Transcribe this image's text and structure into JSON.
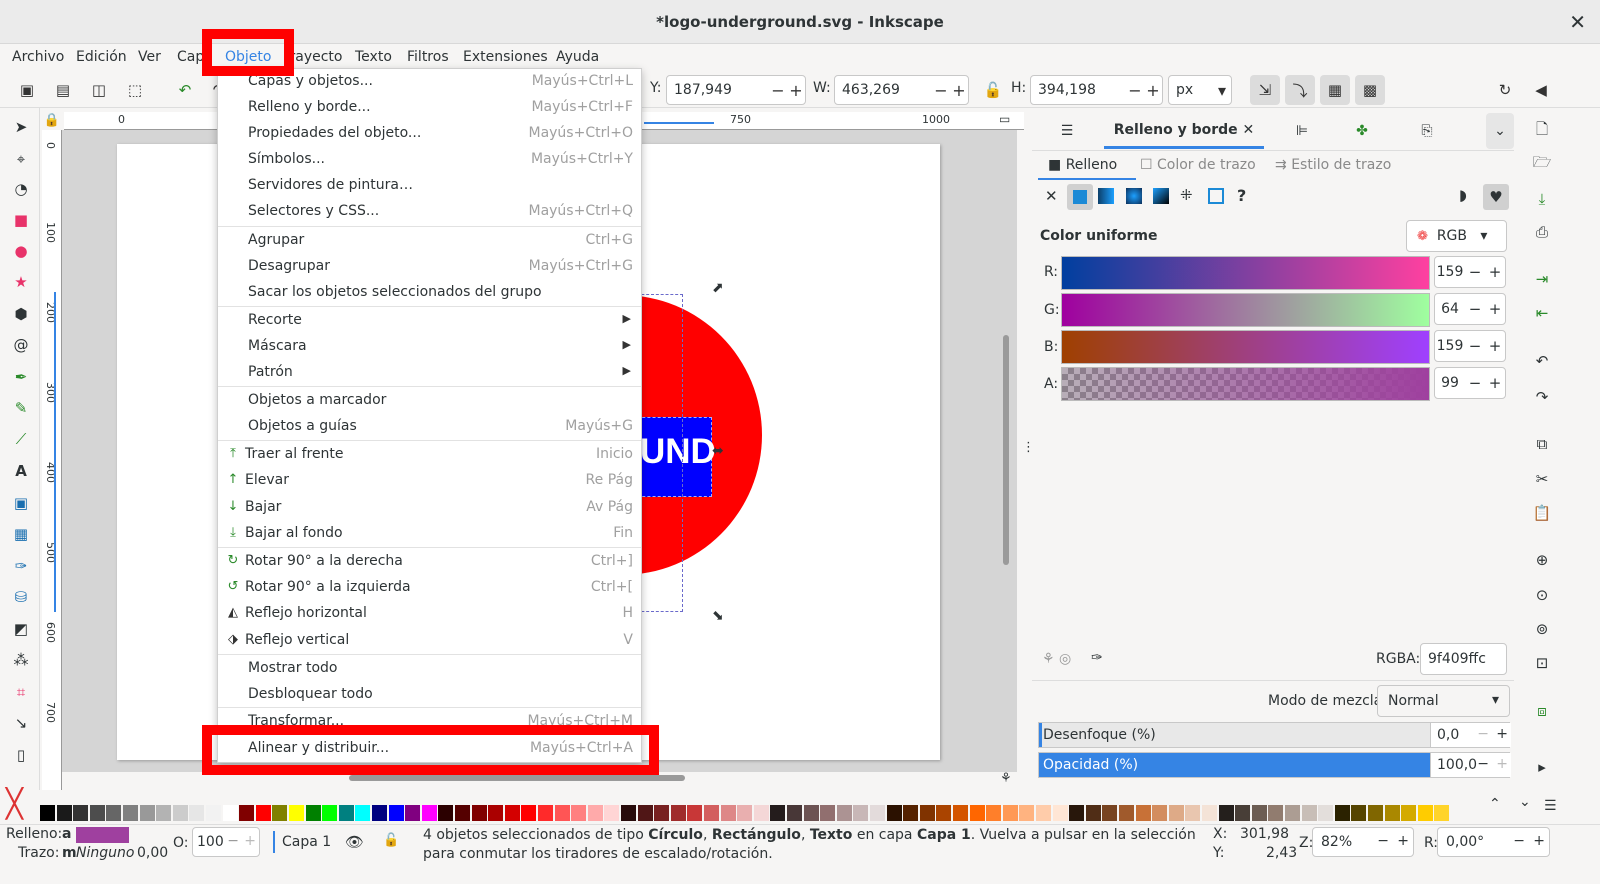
{
  "window": {
    "title": "*logo-underground.svg - Inkscape",
    "close_icon": "close-icon"
  },
  "menubar": [
    "Archivo",
    "Edición",
    "Ver",
    "Capa",
    "Objeto",
    "Trayecto",
    "Texto",
    "Filtros",
    "Extensiones",
    "Ayuda"
  ],
  "toolbar": {
    "y_label": "Y:",
    "y_value": "187,949",
    "w_label": "W:",
    "w_value": "463,269",
    "h_label": "H:",
    "h_value": "394,198",
    "unit": "px"
  },
  "ruler": {
    "top_ticks": [
      "0",
      "750",
      "1000"
    ],
    "left_ticks": [
      "0",
      "100",
      "200",
      "300",
      "400",
      "500",
      "600",
      "700"
    ]
  },
  "canvas": {
    "visible_text": "UND"
  },
  "dropdown": {
    "items": [
      {
        "label": "Capas y objetos...",
        "shortcut": "Mayús+Ctrl+L"
      },
      {
        "label": "Relleno y borde...",
        "shortcut": "Mayús+Ctrl+F"
      },
      {
        "label": "Propiedades del objeto...",
        "shortcut": "Mayús+Ctrl+O"
      },
      {
        "label": "Símbolos...",
        "shortcut": "Mayús+Ctrl+Y"
      },
      {
        "label": "Servidores de pintura…",
        "shortcut": ""
      },
      {
        "label": "Selectores y CSS...",
        "shortcut": "Mayús+Ctrl+Q"
      },
      {
        "label": "Agrupar",
        "shortcut": "Ctrl+G"
      },
      {
        "label": "Desagrupar",
        "shortcut": "Mayús+Ctrl+G"
      },
      {
        "label": "Sacar los objetos seleccionados del grupo",
        "shortcut": ""
      },
      {
        "label": "Recorte",
        "shortcut": ""
      },
      {
        "label": "Máscara",
        "shortcut": ""
      },
      {
        "label": "Patrón",
        "shortcut": ""
      },
      {
        "label": "Objetos a marcador",
        "shortcut": ""
      },
      {
        "label": "Objetos a guías",
        "shortcut": "Mayús+G"
      },
      {
        "label": "Traer al frente",
        "shortcut": "Inicio"
      },
      {
        "label": "Elevar",
        "shortcut": "Re Pág"
      },
      {
        "label": "Bajar",
        "shortcut": "Av Pág"
      },
      {
        "label": "Bajar al fondo",
        "shortcut": "Fin"
      },
      {
        "label": "Rotar 90° a la derecha",
        "shortcut": "Ctrl+]"
      },
      {
        "label": "Rotar 90° a la izquierda",
        "shortcut": "Ctrl+["
      },
      {
        "label": "Reflejo horizontal",
        "shortcut": "H"
      },
      {
        "label": "Reflejo vertical",
        "shortcut": "V"
      },
      {
        "label": "Mostrar todo",
        "shortcut": ""
      },
      {
        "label": "Desbloquear todo",
        "shortcut": ""
      },
      {
        "label": "Transformar...",
        "shortcut": "Mayús+Ctrl+M"
      },
      {
        "label": "Alinear y distribuir...",
        "shortcut": "Mayús+Ctrl+A"
      }
    ]
  },
  "panel": {
    "tab_active": "Relleno y borde",
    "subtabs": [
      "Relleno",
      "Color de trazo",
      "Estilo de trazo"
    ],
    "flat_color": "Color uniforme",
    "color_mode": "RGB",
    "channels": [
      {
        "label": "R:",
        "value": "159"
      },
      {
        "label": "G:",
        "value": "64"
      },
      {
        "label": "B:",
        "value": "159"
      },
      {
        "label": "A:",
        "value": "99"
      }
    ],
    "rgba_label": "RGBA:",
    "rgba_value": "9f409ffc",
    "blend_label": "Modo de mezcla:",
    "blend_value": "Normal",
    "blur_label": "Desenfoque (%)",
    "blur_value": "0,0",
    "opacity_label": "Opacidad (%)",
    "opacity_value": "100,0"
  },
  "status": {
    "fill_label": "Relleno:",
    "fill_a": "a",
    "stroke_label": "Trazo:",
    "stroke_m": "m",
    "stroke_none": "Ninguno",
    "stroke_width": "0,00",
    "opacity_label": "O:",
    "opacity_value": "100",
    "layer": "Capa 1",
    "msg_prefix": "4 objetos seleccionados de tipo",
    "msg_t1": "Círculo",
    "msg_t2": "Rectángulo",
    "msg_t3": "Texto",
    "msg_mid": "en capa",
    "msg_layer": "Capa 1",
    "msg_suffix": ". Vuelva a pulsar en la selección para conmutar los tiradores de escalado/rotación.",
    "x_label": "X:",
    "x_value": "301,98",
    "y_label": "Y:",
    "y_value": "2,43",
    "zoom_label": "Z:",
    "zoom_value": "82%",
    "rot_label": "R:",
    "rot_value": "0,00°"
  },
  "colors": {
    "highlight": "#ff0000",
    "accent": "#3584e4",
    "selected_fill": "#9f409f"
  }
}
